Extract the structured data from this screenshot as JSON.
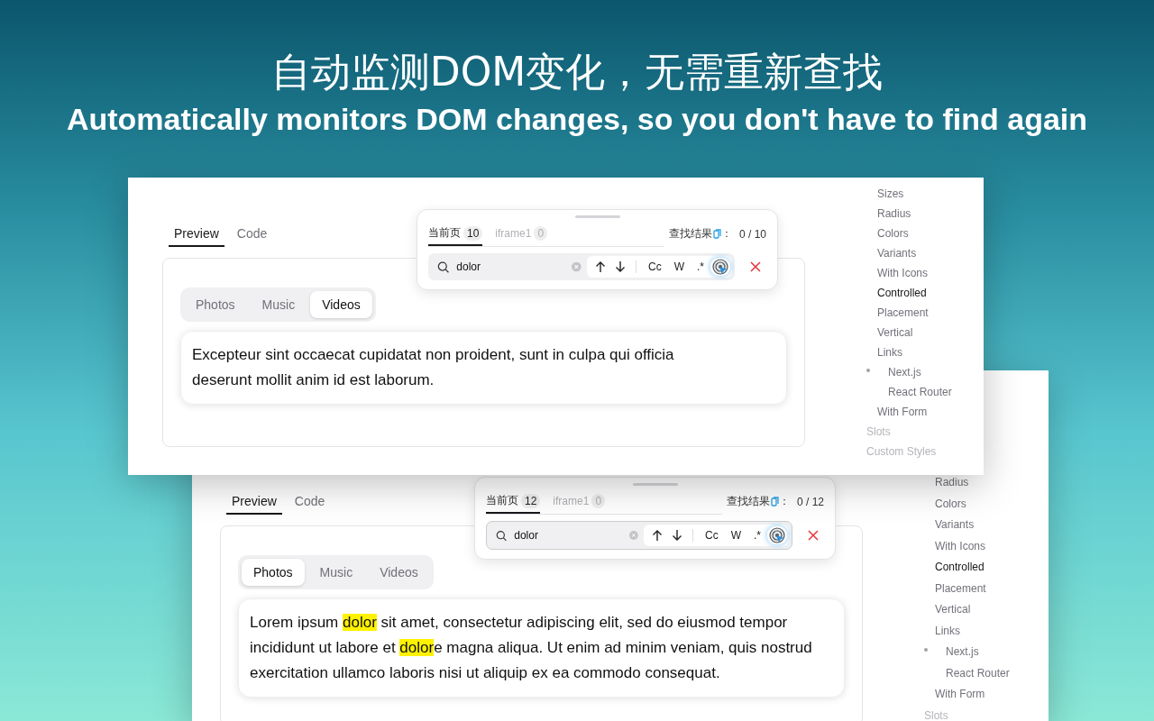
{
  "headline": {
    "title": "自动监测DOM变化，无需重新查找",
    "subtitle": "Automatically monitors DOM changes, so you don't have to find again"
  },
  "panels": [
    {
      "tabs": [
        {
          "label": "Preview",
          "selected": true
        },
        {
          "label": "Code",
          "selected": false
        }
      ],
      "segments": [
        {
          "label": "Photos",
          "selected": false
        },
        {
          "label": "Music",
          "selected": false
        },
        {
          "label": "Videos",
          "selected": true
        }
      ],
      "text": [
        {
          "text": "Excepteur sint occaecat cupidatat non proident, sunt in culpa qui officia deserunt mollit anim id est laborum.",
          "highlighted": false
        }
      ],
      "find_bar": {
        "tabs": [
          {
            "label": "当前页",
            "count": "10",
            "selected": true
          },
          {
            "label": "iframe1",
            "count": "0",
            "selected": false
          }
        ],
        "result_label": "查找结果",
        "colon": "：",
        "result": "0 / 10",
        "value": "dolor",
        "options": [
          "Cc",
          "W",
          ".*"
        ]
      },
      "sidebar": [
        {
          "label": "Sizes",
          "kind": "link",
          "selected": false
        },
        {
          "label": "Radius",
          "kind": "link",
          "selected": false
        },
        {
          "label": "Colors",
          "kind": "link",
          "selected": false
        },
        {
          "label": "Variants",
          "kind": "link",
          "selected": false
        },
        {
          "label": "With Icons",
          "kind": "link",
          "selected": false
        },
        {
          "label": "Controlled",
          "kind": "link",
          "selected": true
        },
        {
          "label": "Placement",
          "kind": "link",
          "selected": false
        },
        {
          "label": "Vertical",
          "kind": "link",
          "selected": false
        },
        {
          "label": "Links",
          "kind": "link",
          "selected": false,
          "children": [
            {
              "label": "Next.js",
              "kind": "link",
              "selected": false,
              "dotted": true
            },
            {
              "label": "React Router",
              "kind": "link",
              "selected": false,
              "dotted": false
            }
          ]
        },
        {
          "label": "With Form",
          "kind": "link",
          "selected": false
        },
        {
          "label": "Slots",
          "kind": "heading",
          "selected": false
        },
        {
          "label": "Custom Styles",
          "kind": "heading",
          "selected": false
        }
      ]
    },
    {
      "tabs": [
        {
          "label": "Preview",
          "selected": true
        },
        {
          "label": "Code",
          "selected": false
        }
      ],
      "segments": [
        {
          "label": "Photos",
          "selected": true
        },
        {
          "label": "Music",
          "selected": false
        },
        {
          "label": "Videos",
          "selected": false
        }
      ],
      "text": [
        {
          "text": "Lorem ipsum ",
          "highlighted": false
        },
        {
          "text": "dolor",
          "highlighted": true
        },
        {
          "text": " sit amet, consectetur adipiscing elit, sed do eiusmod tempor incididunt ut labore et ",
          "highlighted": false
        },
        {
          "text": "dolor",
          "highlighted": true
        },
        {
          "text": "e magna aliqua. Ut enim ad minim veniam, quis nostrud exercitation ullamco laboris nisi ut aliquip ex ea commodo consequat.",
          "highlighted": false
        }
      ],
      "find_bar": {
        "tabs": [
          {
            "label": "当前页",
            "count": "12",
            "selected": true
          },
          {
            "label": "iframe1",
            "count": "0",
            "selected": false
          }
        ],
        "result_label": "查找结果",
        "colon": "：",
        "result": "0 / 12",
        "value": "dolor",
        "options": [
          "Cc",
          "W",
          ".*"
        ]
      },
      "sidebar": [
        {
          "label": "Radius",
          "kind": "link",
          "selected": false
        },
        {
          "label": "Colors",
          "kind": "link",
          "selected": false
        },
        {
          "label": "Variants",
          "kind": "link",
          "selected": false
        },
        {
          "label": "With Icons",
          "kind": "link",
          "selected": false
        },
        {
          "label": "Controlled",
          "kind": "link",
          "selected": true
        },
        {
          "label": "Placement",
          "kind": "link",
          "selected": false
        },
        {
          "label": "Vertical",
          "kind": "link",
          "selected": false
        },
        {
          "label": "Links",
          "kind": "link",
          "selected": false,
          "children": [
            {
              "label": "Next.js",
              "kind": "link",
              "selected": false,
              "dotted": true
            },
            {
              "label": "React Router",
              "kind": "link",
              "selected": false,
              "dotted": false
            }
          ]
        },
        {
          "label": "With Form",
          "kind": "link",
          "selected": false
        },
        {
          "label": "Slots",
          "kind": "heading",
          "selected": false
        }
      ]
    }
  ]
}
